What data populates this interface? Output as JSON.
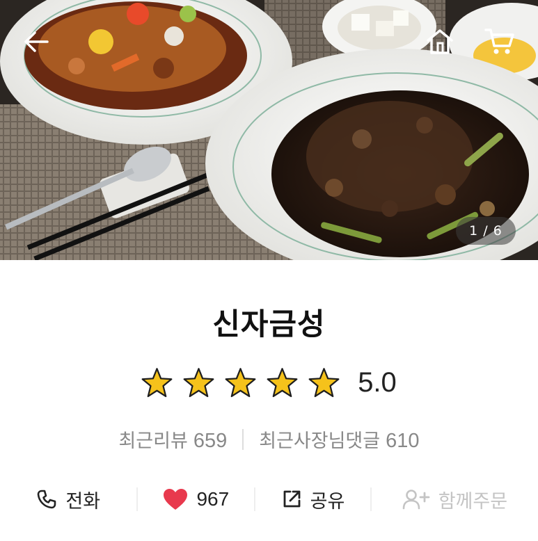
{
  "hero": {
    "photo_index": "1 / 6",
    "icons": {
      "back": "arrow-left-icon",
      "home": "home-icon",
      "cart": "cart-icon"
    }
  },
  "store": {
    "name": "신자금성",
    "rating": "5.0",
    "star_count": 5,
    "star_color": "#f5c21b",
    "recent_reviews_label": "최근리뷰",
    "recent_reviews_count": "659",
    "owner_replies_label": "최근사장님댓글",
    "owner_replies_count": "610"
  },
  "actions": {
    "call_label": "전화",
    "like_count": "967",
    "share_label": "공유",
    "group_order_label": "함께주문",
    "like_color": "#e8394d",
    "disabled_color": "#c4c4c4"
  }
}
